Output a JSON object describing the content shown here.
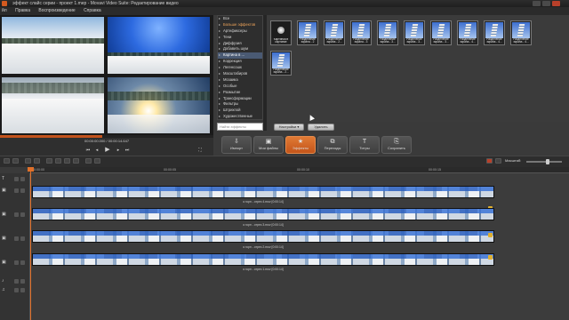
{
  "window": {
    "title": "эффект слайс серии - проект 1.mep - Movavi Video Suite: Редактирование видео"
  },
  "menu": [
    "йл",
    "Правка",
    "Воспроизведение",
    "Справка"
  ],
  "effects": {
    "categories": [
      {
        "label": "Все"
      },
      {
        "label": "Больше эффектов"
      },
      {
        "label": "Артефиксеры"
      },
      {
        "label": "Тени"
      },
      {
        "label": "Диффузия"
      },
      {
        "label": "Добавить шум"
      },
      {
        "label": "Картина в ..."
      },
      {
        "label": "Коррекция"
      },
      {
        "label": "Легенсошк"
      },
      {
        "label": "Масштабиров"
      },
      {
        "label": "Мозаика"
      },
      {
        "label": "Особые"
      },
      {
        "label": "Размытие"
      },
      {
        "label": "Трансформации"
      },
      {
        "label": "Фильтры"
      },
      {
        "label": "Штрихпой"
      },
      {
        "label": "Художественные"
      }
    ],
    "selected_index": 6,
    "search_placeholder": "Найти эффекты",
    "thumbnails": [
      {
        "caption": "Картинка в картинке"
      },
      {
        "caption": "Разделение экрана - 2"
      },
      {
        "caption": "Разделение экрана - 2..."
      },
      {
        "caption": "Разделение экрана - 3"
      },
      {
        "caption": "Разделение экрана - 3..."
      },
      {
        "caption": "Разделение экрана - 3..."
      },
      {
        "caption": "Разделение экрана - 3..."
      },
      {
        "caption": "Разделение экрана - 4..."
      },
      {
        "caption": "Разделение экрана - 4..."
      },
      {
        "caption": "Разделение экрана - 4..."
      },
      {
        "caption": "Разделение экрана - 2..."
      }
    ],
    "settings_label": "Настройки ▾",
    "delete_label": "Удалить"
  },
  "player": {
    "timecode_current": "00:00:00.000",
    "timecode_total": "00:00:14.647",
    "progress_fraction": 0.48
  },
  "toolbar": {
    "buttons": [
      {
        "icon": "import-icon",
        "glyph": "⇩",
        "label": "Импорт"
      },
      {
        "icon": "files-icon",
        "glyph": "▣",
        "label": "Мои файлы"
      },
      {
        "icon": "effects-icon",
        "glyph": "★",
        "label": "Эффекты"
      },
      {
        "icon": "transitions-icon",
        "glyph": "⧉",
        "label": "Переходы"
      },
      {
        "icon": "titles-icon",
        "glyph": "T",
        "label": "Титры"
      },
      {
        "icon": "save-icon",
        "glyph": "⎘",
        "label": "Сохранить"
      }
    ]
  },
  "timeline": {
    "zoom_label": "Масштаб:",
    "ruler": [
      "00:00:00",
      "00:00:05",
      "00:00:10",
      "00:00:15"
    ],
    "clips": [
      {
        "label": "♦ горн - отрез 4.mov [0:00:14]"
      },
      {
        "label": "♦ горн - отрез 3.mov [0:00:14]"
      },
      {
        "label": "♦ горн - отрез 2.mov [0:00:14]"
      },
      {
        "label": "♦ горн - отрез 1.mov [0:00:14]"
      }
    ]
  },
  "colors": {
    "accent": "#e07a35",
    "playhead": "#e0702a",
    "selected_category": "#4a5a73"
  }
}
